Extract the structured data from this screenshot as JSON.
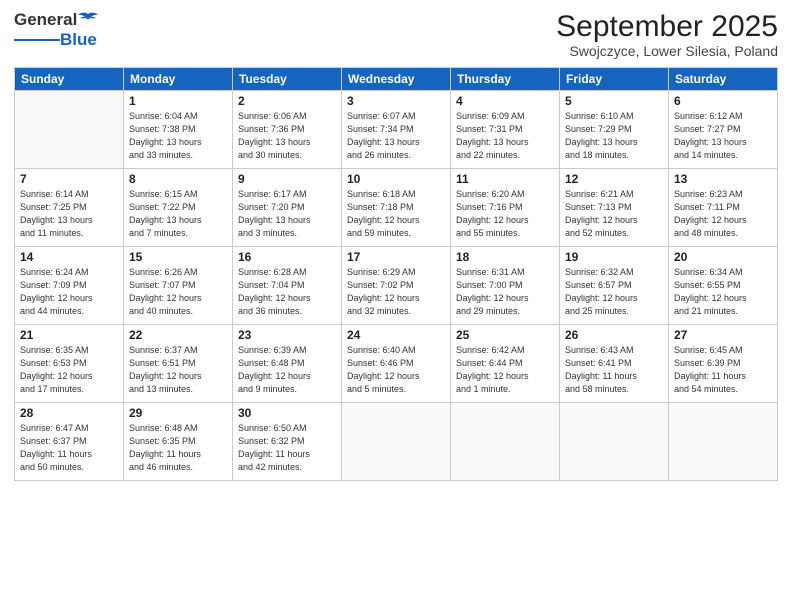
{
  "logo": {
    "general": "General",
    "blue": "Blue"
  },
  "title": "September 2025",
  "subtitle": "Swojczyce, Lower Silesia, Poland",
  "weekdays": [
    "Sunday",
    "Monday",
    "Tuesday",
    "Wednesday",
    "Thursday",
    "Friday",
    "Saturday"
  ],
  "weeks": [
    [
      {
        "day": "",
        "info": ""
      },
      {
        "day": "1",
        "info": "Sunrise: 6:04 AM\nSunset: 7:38 PM\nDaylight: 13 hours\nand 33 minutes."
      },
      {
        "day": "2",
        "info": "Sunrise: 6:06 AM\nSunset: 7:36 PM\nDaylight: 13 hours\nand 30 minutes."
      },
      {
        "day": "3",
        "info": "Sunrise: 6:07 AM\nSunset: 7:34 PM\nDaylight: 13 hours\nand 26 minutes."
      },
      {
        "day": "4",
        "info": "Sunrise: 6:09 AM\nSunset: 7:31 PM\nDaylight: 13 hours\nand 22 minutes."
      },
      {
        "day": "5",
        "info": "Sunrise: 6:10 AM\nSunset: 7:29 PM\nDaylight: 13 hours\nand 18 minutes."
      },
      {
        "day": "6",
        "info": "Sunrise: 6:12 AM\nSunset: 7:27 PM\nDaylight: 13 hours\nand 14 minutes."
      }
    ],
    [
      {
        "day": "7",
        "info": "Sunrise: 6:14 AM\nSunset: 7:25 PM\nDaylight: 13 hours\nand 11 minutes."
      },
      {
        "day": "8",
        "info": "Sunrise: 6:15 AM\nSunset: 7:22 PM\nDaylight: 13 hours\nand 7 minutes."
      },
      {
        "day": "9",
        "info": "Sunrise: 6:17 AM\nSunset: 7:20 PM\nDaylight: 13 hours\nand 3 minutes."
      },
      {
        "day": "10",
        "info": "Sunrise: 6:18 AM\nSunset: 7:18 PM\nDaylight: 12 hours\nand 59 minutes."
      },
      {
        "day": "11",
        "info": "Sunrise: 6:20 AM\nSunset: 7:16 PM\nDaylight: 12 hours\nand 55 minutes."
      },
      {
        "day": "12",
        "info": "Sunrise: 6:21 AM\nSunset: 7:13 PM\nDaylight: 12 hours\nand 52 minutes."
      },
      {
        "day": "13",
        "info": "Sunrise: 6:23 AM\nSunset: 7:11 PM\nDaylight: 12 hours\nand 48 minutes."
      }
    ],
    [
      {
        "day": "14",
        "info": "Sunrise: 6:24 AM\nSunset: 7:09 PM\nDaylight: 12 hours\nand 44 minutes."
      },
      {
        "day": "15",
        "info": "Sunrise: 6:26 AM\nSunset: 7:07 PM\nDaylight: 12 hours\nand 40 minutes."
      },
      {
        "day": "16",
        "info": "Sunrise: 6:28 AM\nSunset: 7:04 PM\nDaylight: 12 hours\nand 36 minutes."
      },
      {
        "day": "17",
        "info": "Sunrise: 6:29 AM\nSunset: 7:02 PM\nDaylight: 12 hours\nand 32 minutes."
      },
      {
        "day": "18",
        "info": "Sunrise: 6:31 AM\nSunset: 7:00 PM\nDaylight: 12 hours\nand 29 minutes."
      },
      {
        "day": "19",
        "info": "Sunrise: 6:32 AM\nSunset: 6:57 PM\nDaylight: 12 hours\nand 25 minutes."
      },
      {
        "day": "20",
        "info": "Sunrise: 6:34 AM\nSunset: 6:55 PM\nDaylight: 12 hours\nand 21 minutes."
      }
    ],
    [
      {
        "day": "21",
        "info": "Sunrise: 6:35 AM\nSunset: 6:53 PM\nDaylight: 12 hours\nand 17 minutes."
      },
      {
        "day": "22",
        "info": "Sunrise: 6:37 AM\nSunset: 6:51 PM\nDaylight: 12 hours\nand 13 minutes."
      },
      {
        "day": "23",
        "info": "Sunrise: 6:39 AM\nSunset: 6:48 PM\nDaylight: 12 hours\nand 9 minutes."
      },
      {
        "day": "24",
        "info": "Sunrise: 6:40 AM\nSunset: 6:46 PM\nDaylight: 12 hours\nand 5 minutes."
      },
      {
        "day": "25",
        "info": "Sunrise: 6:42 AM\nSunset: 6:44 PM\nDaylight: 12 hours\nand 1 minute."
      },
      {
        "day": "26",
        "info": "Sunrise: 6:43 AM\nSunset: 6:41 PM\nDaylight: 11 hours\nand 58 minutes."
      },
      {
        "day": "27",
        "info": "Sunrise: 6:45 AM\nSunset: 6:39 PM\nDaylight: 11 hours\nand 54 minutes."
      }
    ],
    [
      {
        "day": "28",
        "info": "Sunrise: 6:47 AM\nSunset: 6:37 PM\nDaylight: 11 hours\nand 50 minutes."
      },
      {
        "day": "29",
        "info": "Sunrise: 6:48 AM\nSunset: 6:35 PM\nDaylight: 11 hours\nand 46 minutes."
      },
      {
        "day": "30",
        "info": "Sunrise: 6:50 AM\nSunset: 6:32 PM\nDaylight: 11 hours\nand 42 minutes."
      },
      {
        "day": "",
        "info": ""
      },
      {
        "day": "",
        "info": ""
      },
      {
        "day": "",
        "info": ""
      },
      {
        "day": "",
        "info": ""
      }
    ]
  ]
}
